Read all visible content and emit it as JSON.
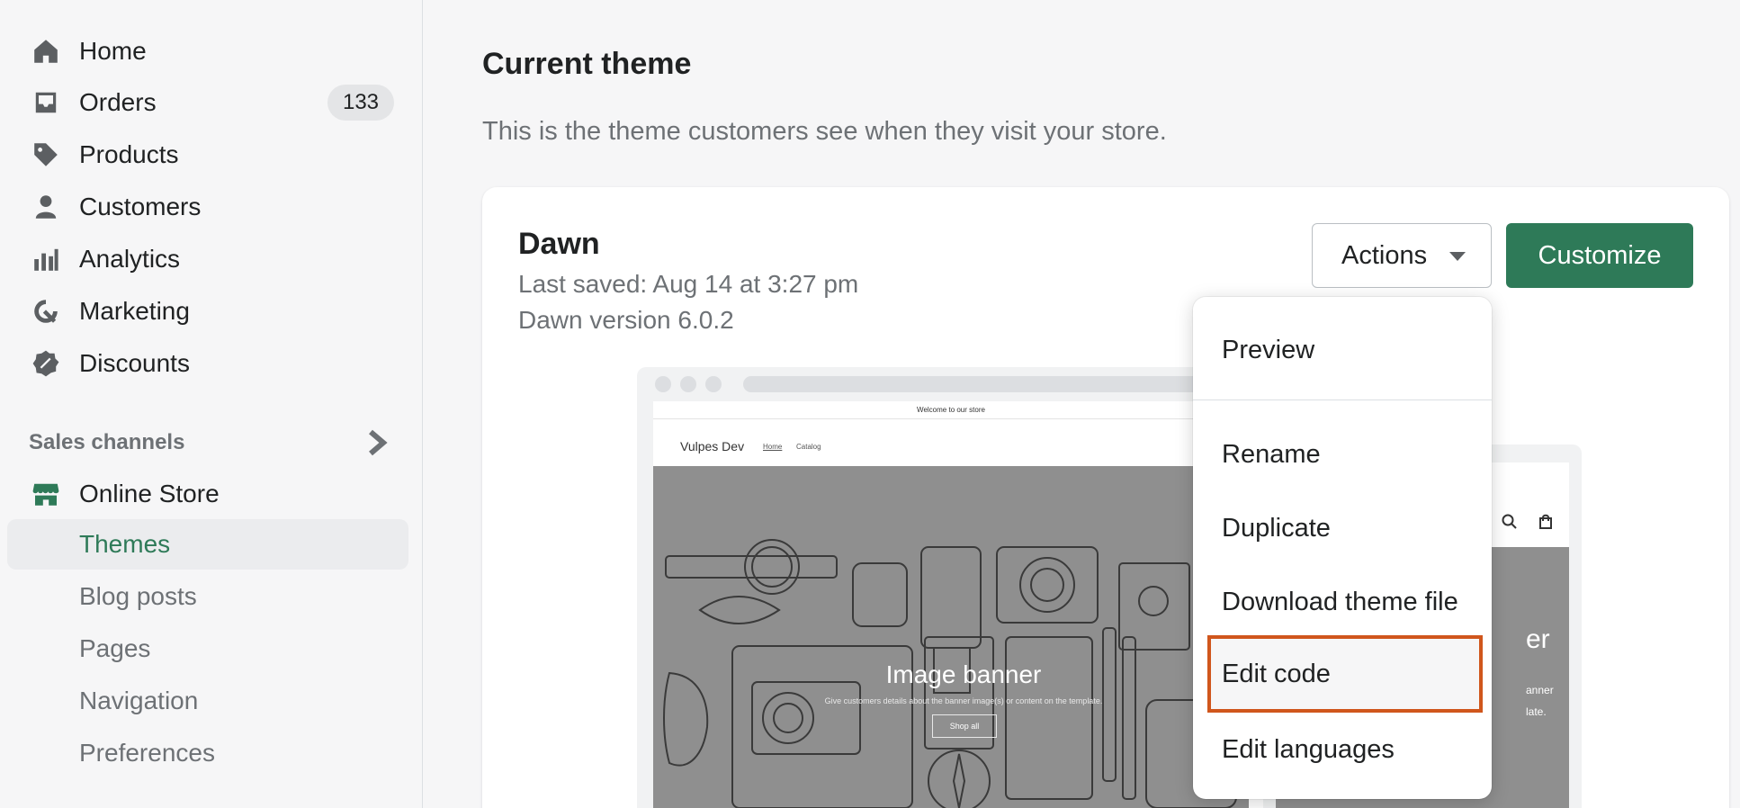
{
  "sidebar": {
    "nav": [
      {
        "label": "Home",
        "icon": "home-icon"
      },
      {
        "label": "Orders",
        "icon": "inbox-icon",
        "badge": "133"
      },
      {
        "label": "Products",
        "icon": "tag-icon"
      },
      {
        "label": "Customers",
        "icon": "person-icon"
      },
      {
        "label": "Analytics",
        "icon": "bar-chart-icon"
      },
      {
        "label": "Marketing",
        "icon": "target-icon"
      },
      {
        "label": "Discounts",
        "icon": "discount-icon"
      }
    ],
    "sales_channels_label": "Sales channels",
    "online_store": {
      "label": "Online Store",
      "icon": "store-icon"
    },
    "online_store_items": [
      {
        "label": "Themes",
        "active": true
      },
      {
        "label": "Blog posts",
        "active": false
      },
      {
        "label": "Pages",
        "active": false
      },
      {
        "label": "Navigation",
        "active": false
      },
      {
        "label": "Preferences",
        "active": false
      }
    ]
  },
  "main": {
    "title": "Current theme",
    "subtitle": "This is the theme customers see when they visit your store."
  },
  "theme_card": {
    "name": "Dawn",
    "last_saved": "Last saved: Aug 14 at 3:27 pm",
    "version": "Dawn version 6.0.2",
    "actions_label": "Actions",
    "customize_label": "Customize"
  },
  "preview": {
    "announcement": "Welcome to our store",
    "store_name": "Vulpes Dev",
    "nav_links": [
      "Home",
      "Catalog"
    ],
    "banner_title": "Image banner",
    "banner_description": "Give customers details about the banner image(s) or content on the template.",
    "banner_button": "Shop all",
    "mobile_title_fragment": "er",
    "mobile_desc_fragments": [
      "anner",
      "late."
    ]
  },
  "actions_menu": {
    "items": [
      "Preview",
      "Rename",
      "Duplicate",
      "Download theme file",
      "Edit code",
      "Edit languages"
    ],
    "highlighted": "Edit code"
  },
  "colors": {
    "accent_green": "#2e7a58",
    "highlight_border": "#d0561c"
  }
}
